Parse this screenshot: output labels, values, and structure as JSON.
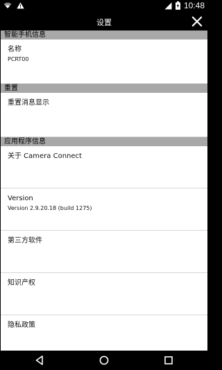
{
  "status_bar": {
    "time": "10:48",
    "icons": [
      "wifi-icon",
      "warning-icon",
      "signal-icon",
      "battery-icon"
    ]
  },
  "title_bar": {
    "title": "设置",
    "close_icon": "close-icon"
  },
  "sections": {
    "device_info": {
      "header": "智能手机信息",
      "name_label": "名称",
      "name_value": "PCRT00"
    },
    "reset": {
      "header": "重置",
      "reset_messages_label": "重置消息显示"
    },
    "app_info": {
      "header": "应用程序信息",
      "about_label": "关于 Camera Connect",
      "version_label": "Version",
      "version_value": "Version 2.9.20.18 (build 1275)",
      "third_party_label": "第三方软件",
      "ip_label": "知识产权",
      "privacy_label": "隐私政策"
    }
  },
  "nav_bar": {
    "icons": [
      "back-icon",
      "home-icon",
      "recents-icon"
    ]
  },
  "colors": {
    "header_bg": "#a8a8a8",
    "bar_bg": "#000000",
    "content_bg": "#ffffff",
    "divider": "#d6d6d6"
  }
}
